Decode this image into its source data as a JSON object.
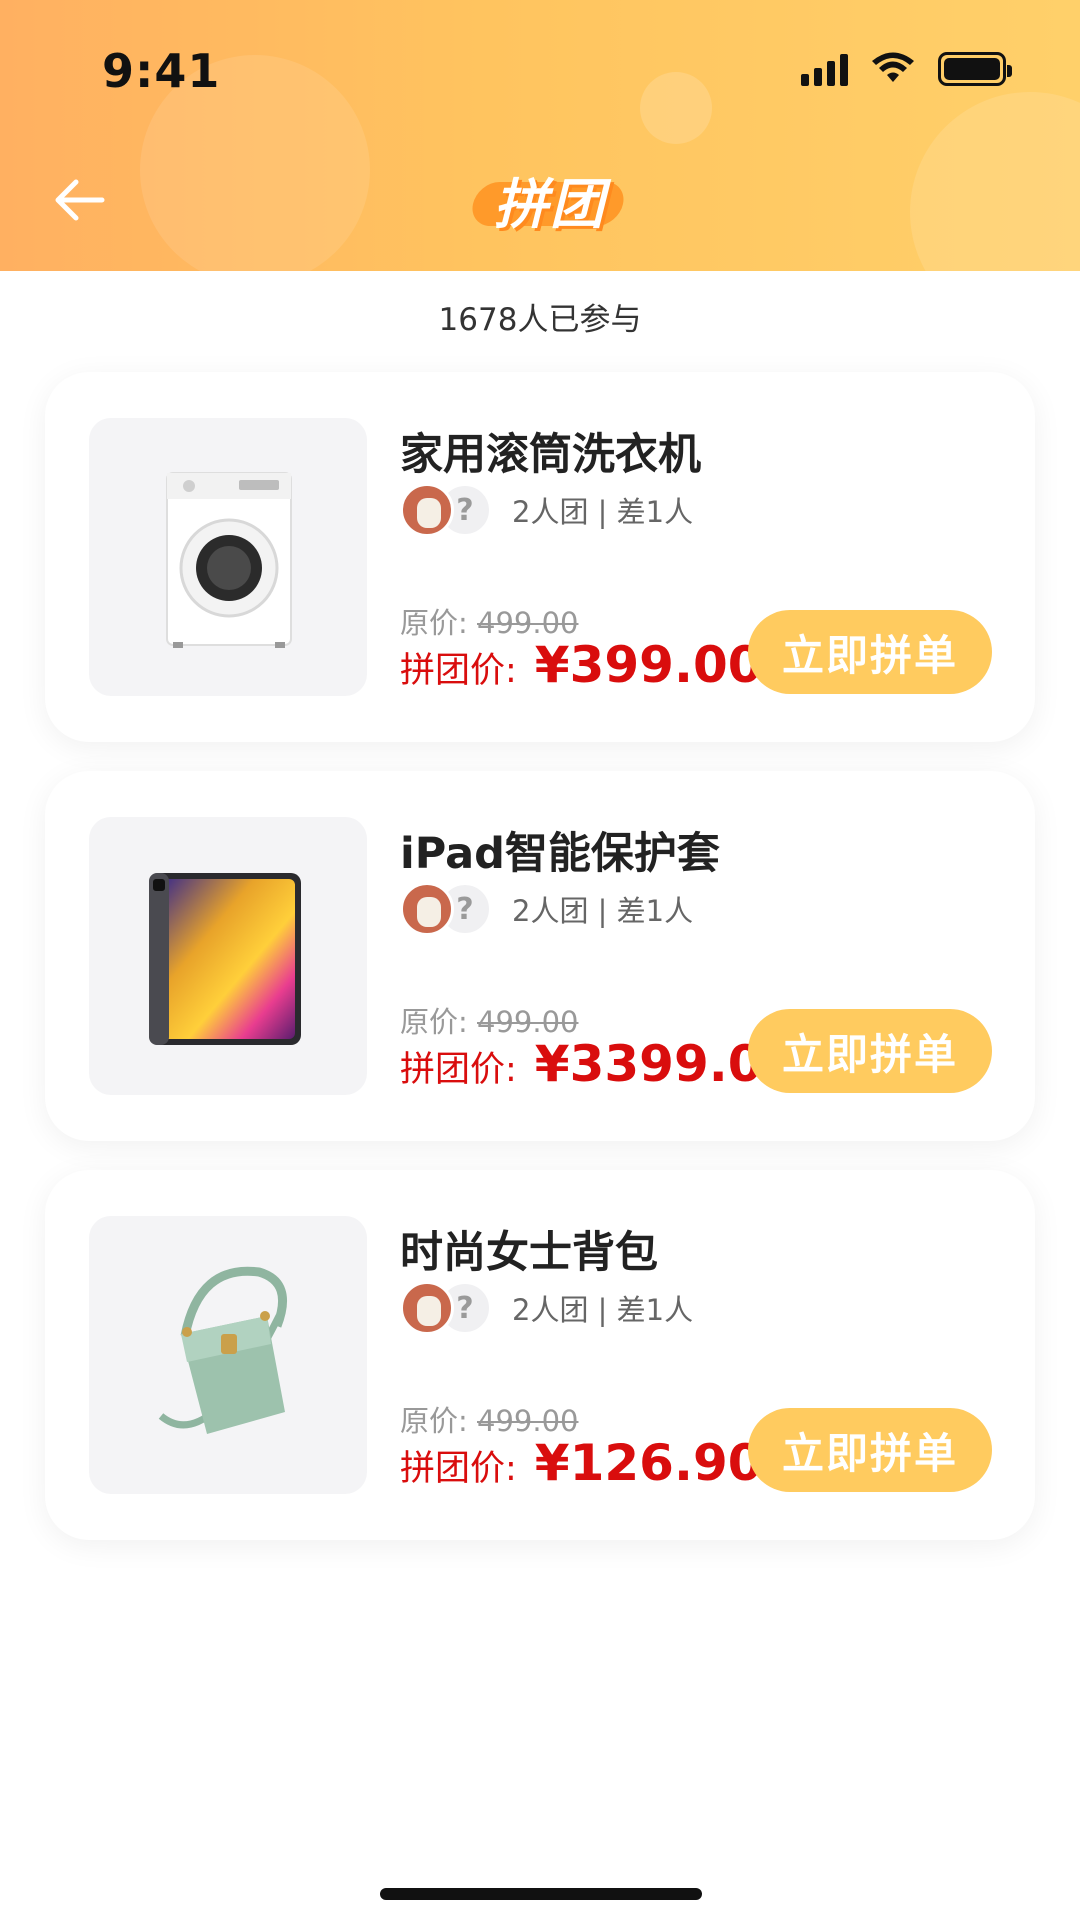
{
  "status": {
    "time": "9:41"
  },
  "header": {
    "title": "拼团",
    "back_icon": "arrow-left-icon"
  },
  "participants": "1678人已参与",
  "products": [
    {
      "name": "家用滚筒洗衣机",
      "group_info": "2人团 | 差1人",
      "original_label": "原价: ",
      "original_price": "499.00",
      "promo_label": "拼团价: ",
      "promo_price": "¥399.00",
      "button": "立即拼单",
      "image": "washing-machine"
    },
    {
      "name": "iPad智能保护套",
      "group_info": "2人团 | 差1人",
      "original_label": "原价: ",
      "original_price": "499.00",
      "promo_label": "拼团价: ",
      "promo_price": "¥3399.00",
      "button": "立即拼单",
      "image": "tablet"
    },
    {
      "name": "时尚女士背包",
      "group_info": "2人团 | 差1人",
      "original_label": "原价: ",
      "original_price": "499.00",
      "promo_label": "拼团价: ",
      "promo_price": "¥126.90",
      "button": "立即拼单",
      "image": "handbag"
    }
  ],
  "avatar_placeholder": "?",
  "colors": {
    "header_start": "#ffb061",
    "header_end": "#ffd06a",
    "accent_price": "#d90d0d",
    "button_bg": "#ffcb5f"
  }
}
